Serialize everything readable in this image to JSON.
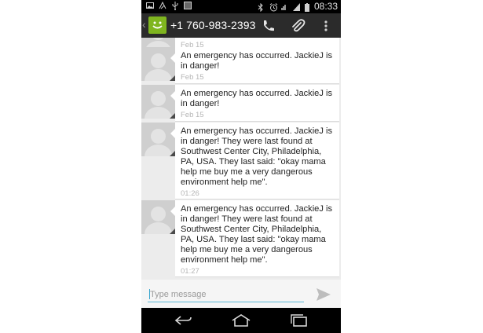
{
  "status_bar": {
    "time": "08:33",
    "left_icons": [
      "image-icon",
      "signal-icon",
      "usb-icon",
      "barcode-icon"
    ],
    "right_icons": [
      "bluetooth-icon",
      "alarm-icon",
      "wifi-icon",
      "cell-signal-icon",
      "battery-icon"
    ]
  },
  "action_bar": {
    "contact": "+1 760-983-2393",
    "icons": [
      "back-chevron-icon",
      "app-smiley-icon",
      "phone-icon",
      "paperclip-icon",
      "overflow-menu-icon"
    ]
  },
  "messages": [
    {
      "text": "",
      "timestamp": "Feb 15",
      "partial": true
    },
    {
      "text": "An emergency has occurred.  JackieJ is in danger!",
      "timestamp": "Feb 15"
    },
    {
      "text": "An emergency has occurred.  JackieJ is in danger!",
      "timestamp": "Feb 15"
    },
    {
      "text": "An emergency has occurred.  JackieJ is in danger! They were last found at Southwest Center City, Philadelphia, PA, USA.  They last said: \"okay mama help me buy me a very dangerous environment help me\".",
      "timestamp": "01:26"
    },
    {
      "text": "An emergency has occurred.  JackieJ is in danger! They were last found at Southwest Center City, Philadelphia, PA, USA.  They last said: \"okay mama help me buy me a very dangerous environment help me\".",
      "timestamp": "01:27"
    }
  ],
  "compose": {
    "placeholder": "Type message",
    "value": ""
  },
  "colors": {
    "action_bar": "#2b2b2b",
    "accent": "#5bb7d6",
    "app_icon": "#7fb51f"
  }
}
